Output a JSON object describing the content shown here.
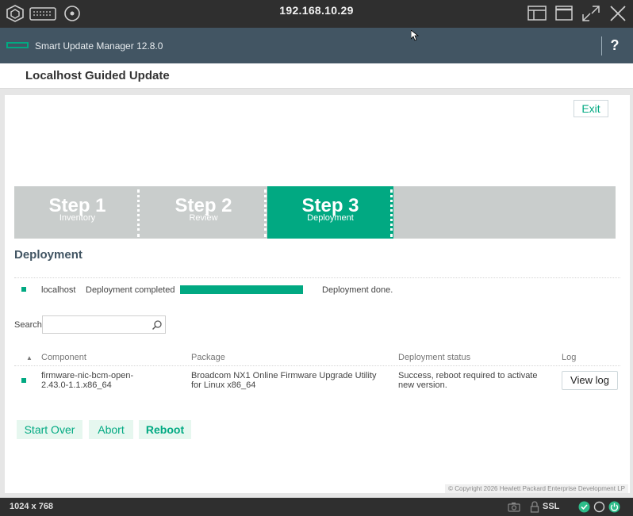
{
  "kvm": {
    "host": "192.168.10.29",
    "resolution": "1024 x 768",
    "ssl_label": "SSL",
    "icons_left": [
      "hexagon-logo-icon",
      "keyboard-icon",
      "disc-icon"
    ],
    "icons_right": [
      "window-layout-icon",
      "maximize-icon",
      "fullscreen-icon",
      "close-icon"
    ],
    "status_icons": [
      "camera-icon",
      "lock-icon",
      "check-circle-icon",
      "circle-icon",
      "power-icon"
    ]
  },
  "app": {
    "name": "Smart Update Manager 12.8.0",
    "help_label": "?"
  },
  "page": {
    "title": "Localhost Guided Update",
    "exit_label": "Exit"
  },
  "steps": [
    {
      "label": "Step 1",
      "sub": "Inventory",
      "active": false
    },
    {
      "label": "Step 2",
      "sub": "Review",
      "active": false
    },
    {
      "label": "Step 3",
      "sub": "Deployment",
      "active": true
    }
  ],
  "deployment": {
    "section_title": "Deployment",
    "host": "localhost",
    "status": "Deployment completed",
    "progress_percent": 100,
    "result": "Deployment done."
  },
  "search": {
    "label": "Search",
    "value": ""
  },
  "table": {
    "sort_indicator": "▲",
    "headers": [
      "Component",
      "Package",
      "Deployment status",
      "Log"
    ],
    "rows": [
      {
        "component": "firmware-nic-bcm-open-2.43.0-1.1.x86_64",
        "package": "Broadcom NX1 Online Firmware Upgrade Utility for Linux x86_64",
        "status": "Success, reboot required to activate new version.",
        "log_label": "View log"
      }
    ]
  },
  "actions": {
    "start_over": "Start Over",
    "abort": "Abort",
    "reboot": "Reboot"
  },
  "footer": {
    "copyright": "© Copyright 2026 Hewlett Packard Enterprise Development LP"
  },
  "colors": {
    "accent": "#01a982",
    "header": "#425563",
    "kvm_bar": "#2f2f2f"
  }
}
